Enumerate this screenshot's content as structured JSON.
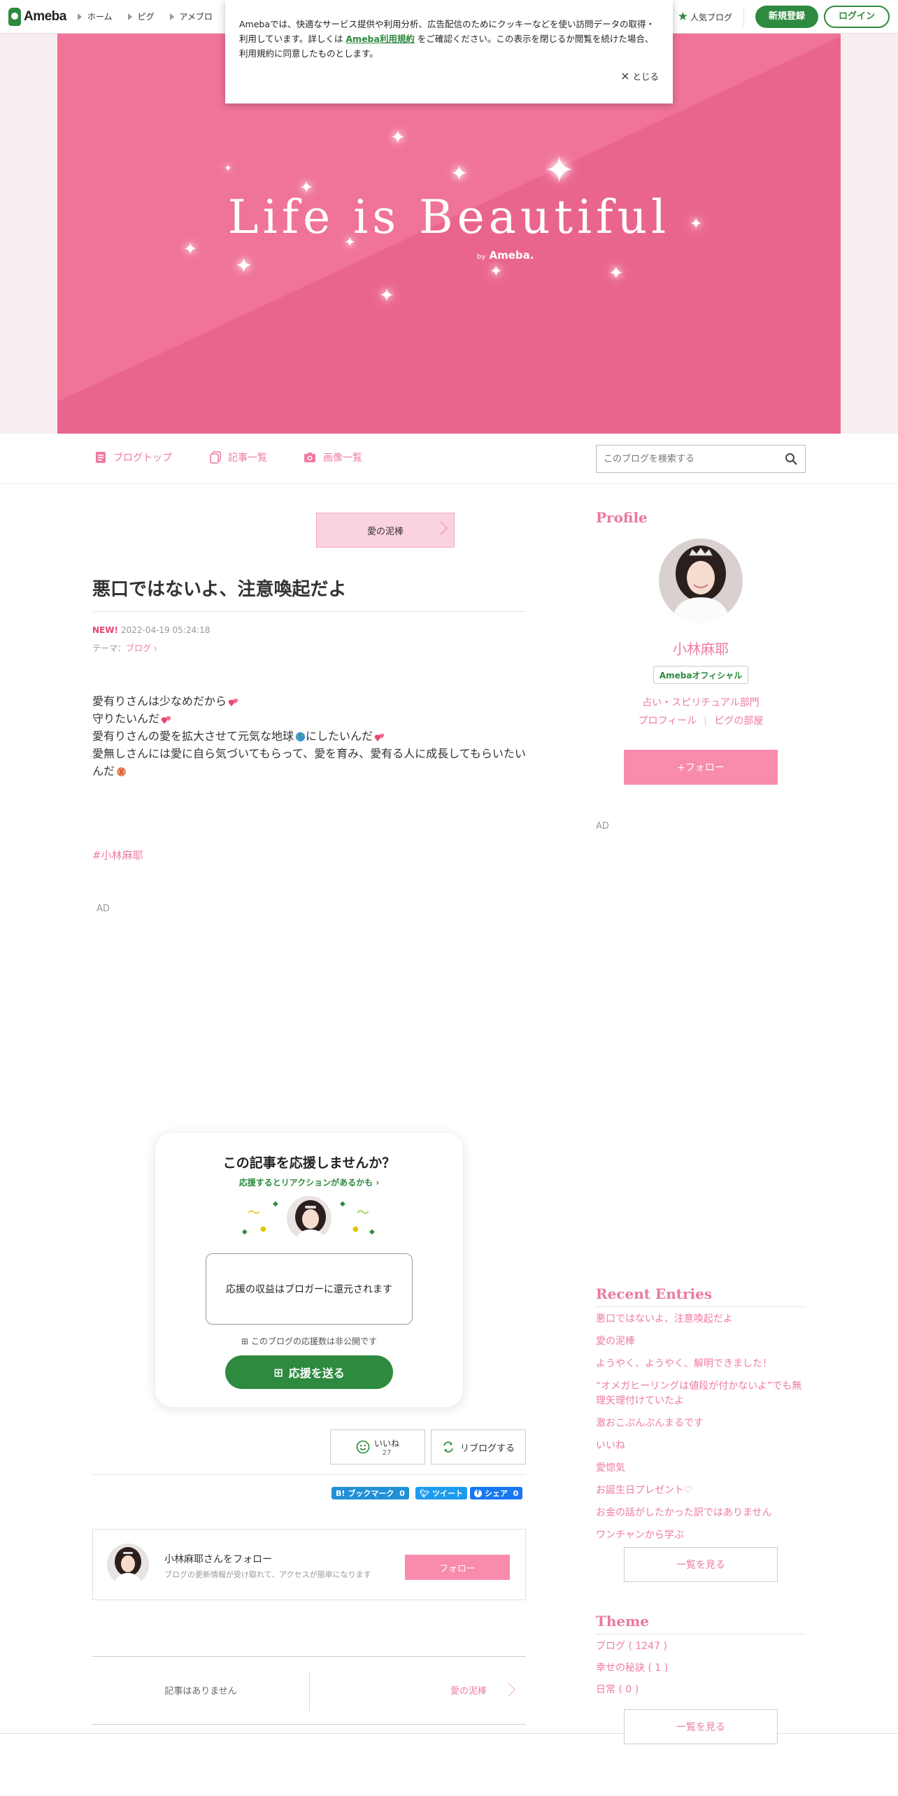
{
  "topbar": {
    "logo": "Ameba",
    "nav": [
      "ホーム",
      "ピグ",
      "アメブロ"
    ],
    "popular": "人気ブログ",
    "register": "新規登録",
    "login": "ログイン"
  },
  "cookie": {
    "text_before": "Amebaでは、快適なサービス提供や利用分析、広告配信のためにクッキーなどを使い訪問データの取得・利用しています。詳しくは",
    "link": "Ameba利用規約",
    "text_after": "をご確認ください。この表示を閉じるか閲覧を続けた場合、利用規約に同意したものとします。",
    "close": "とじる"
  },
  "banner": {
    "title": "Life is Beautiful",
    "by": "by",
    "brand": "Ameba."
  },
  "subnav": {
    "top": "ブログトップ",
    "list": "記事一覧",
    "images": "画像一覧",
    "search_placeholder": "このブログを検索する"
  },
  "article": {
    "next_title": "愛の泥棒",
    "title": "悪口ではないよ、注意喚起だよ",
    "new": "NEW!",
    "date": "2022-04-19 05:24:18",
    "theme_label": "テーマ：",
    "theme": "ブログ",
    "lines": [
      "愛有りさんは少なめだから",
      "守りたいんだ",
      "愛有りさんの愛を拡大させて元気な地球",
      "にしたいんだ",
      "愛無しさんには愛に自ら気づいてもらって、愛を育み、愛有る人に成長してもらいたいんだ"
    ],
    "hashtag": "#小林麻耶",
    "ad": "AD"
  },
  "support": {
    "title": "この記事を応援しませんか？",
    "subtitle": "応援するとリアクションがあるかも",
    "box": "応援の収益はブロガーに還元されます",
    "note": "このブログの応援数は非公開です",
    "button": "応援を送る"
  },
  "reactions": {
    "like": "いいね",
    "like_count": "27",
    "reblog": "リブログする",
    "bookmark": "ブックマーク",
    "bookmark_count": "0",
    "tweet": "ツイート",
    "share": "シェア",
    "share_count": "0"
  },
  "follow_box": {
    "name": "小林麻耶さんをフォロー",
    "desc": "ブログの更新情報が受け取れて、アクセスが簡単になります",
    "button": "フォロー"
  },
  "pager": {
    "prev": "記事はありません",
    "next": "愛の泥棒"
  },
  "sidebar": {
    "profile_head": "Profile",
    "name": "小林麻耶",
    "official": "Amebaオフィシャル",
    "category": "占い・スピリチュアル部門",
    "profile_link": "プロフィール",
    "pig_link": "ピグの部屋",
    "follow": "+フォロー",
    "ad": "AD",
    "recent_head": "Recent Entries",
    "entries": [
      "悪口ではないよ、注意喚起だよ",
      "愛の泥棒",
      "ようやく、ようやく、解明できました！",
      "“オメガヒーリングは値段が付かないよ”でも無理矢理付けていたよ",
      "激おこぷんぷんまるです",
      "いいね",
      "愛惚気",
      "お誕生日プレゼント♡",
      "お金の話がしたかった訳ではありません",
      "ワンチャンから学ぶ"
    ],
    "more": "一覧を見る",
    "theme_head": "Theme",
    "themes": [
      "ブログ ( 1247 )",
      "幸せの秘訣 ( 1 )",
      "日常 ( 0 )"
    ]
  },
  "colors": {
    "brand_green": "#2d8a3e",
    "pink_accent": "#ef7ca0",
    "banner_pink": "#ee6d93"
  }
}
